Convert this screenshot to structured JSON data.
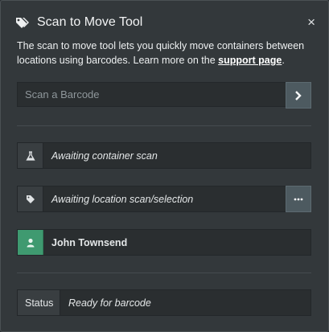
{
  "header": {
    "title": "Scan to Move Tool",
    "close_label": "×",
    "icon": "tags-icon"
  },
  "intro": {
    "text_before": "The scan to move tool lets you quickly move containers between locations using barcodes. Learn more on the ",
    "link_text": "support page",
    "text_after": "."
  },
  "scan": {
    "placeholder": "Scan a Barcode",
    "value": "",
    "submit_icon": "chevron-right-icon"
  },
  "container": {
    "icon": "flask-icon",
    "text": "Awaiting container scan"
  },
  "location": {
    "icon": "tag-icon",
    "text": "Awaiting location scan/selection",
    "more_icon": "ellipsis-icon"
  },
  "user": {
    "icon": "user-icon",
    "name": "John Townsend",
    "accent": "#3f9a70"
  },
  "status": {
    "label": "Status",
    "text": "Ready for barcode"
  }
}
